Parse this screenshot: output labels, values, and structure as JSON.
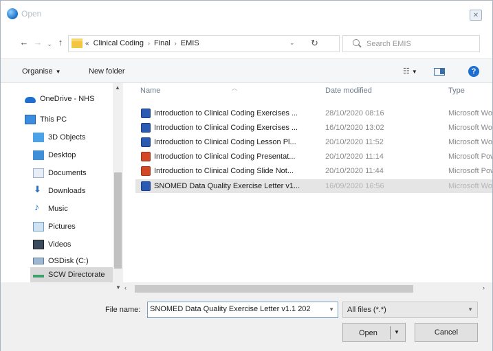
{
  "window": {
    "title": "Open"
  },
  "nav": {
    "recent": "⌄",
    "up": "↑",
    "back": "←",
    "forward": "→",
    "refresh": "↻"
  },
  "address": {
    "prefix": "«",
    "crumbs": [
      "Clinical Coding",
      "Final",
      "EMIS"
    ]
  },
  "search": {
    "placeholder": "Search EMIS"
  },
  "toolbar": {
    "organise": "Organise",
    "new_folder": "New folder"
  },
  "sidebar": {
    "items": [
      {
        "label": "OneDrive - NHS",
        "icon": "onedrive-icon"
      },
      {
        "label": "This PC",
        "icon": "this-pc-icon"
      },
      {
        "label": "3D Objects",
        "icon": "3d-objects-icon"
      },
      {
        "label": "Desktop",
        "icon": "desktop-icon"
      },
      {
        "label": "Documents",
        "icon": "documents-icon"
      },
      {
        "label": "Downloads",
        "icon": "downloads-icon"
      },
      {
        "label": "Music",
        "icon": "music-icon"
      },
      {
        "label": "Pictures",
        "icon": "pictures-icon"
      },
      {
        "label": "Videos",
        "icon": "videos-icon"
      },
      {
        "label": "OSDisk (C:)",
        "icon": "disk-icon"
      },
      {
        "label": "SCW Directorate",
        "icon": "network-drive-icon"
      }
    ]
  },
  "columns": {
    "name": "Name",
    "date": "Date modified",
    "type": "Type"
  },
  "files": [
    {
      "name": "Introduction to Clinical Coding Exercises ...",
      "date": "28/10/2020 08:16",
      "type": "Microsoft Word",
      "kind": "word"
    },
    {
      "name": "Introduction to Clinical Coding Exercises ...",
      "date": "16/10/2020 13:02",
      "type": "Microsoft Word",
      "kind": "word"
    },
    {
      "name": "Introduction to Clinical Coding Lesson Pl...",
      "date": "20/10/2020 11:52",
      "type": "Microsoft Word",
      "kind": "word"
    },
    {
      "name": "Introduction to Clinical Coding Presentat...",
      "date": "20/10/2020 11:14",
      "type": "Microsoft Power",
      "kind": "ppt"
    },
    {
      "name": "Introduction to Clinical Coding Slide Not...",
      "date": "20/10/2020 11:44",
      "type": "Microsoft Power",
      "kind": "ppt"
    },
    {
      "name": "SNOMED Data Quality Exercise Letter v1...",
      "date": "16/09/2020 16:56",
      "type": "Microsoft Word",
      "kind": "word",
      "selected": true
    }
  ],
  "bottom": {
    "file_name_label": "File name:",
    "file_name_value": "SNOMED Data Quality Exercise Letter v1.1 202",
    "filter_value": "All files (*.*)",
    "open_label": "Open",
    "cancel_label": "Cancel"
  },
  "colors": {
    "accent": "#1d6fd1",
    "selection": "#e5e5e5",
    "word": "#2b5ab3",
    "powerpoint": "#d24726"
  }
}
